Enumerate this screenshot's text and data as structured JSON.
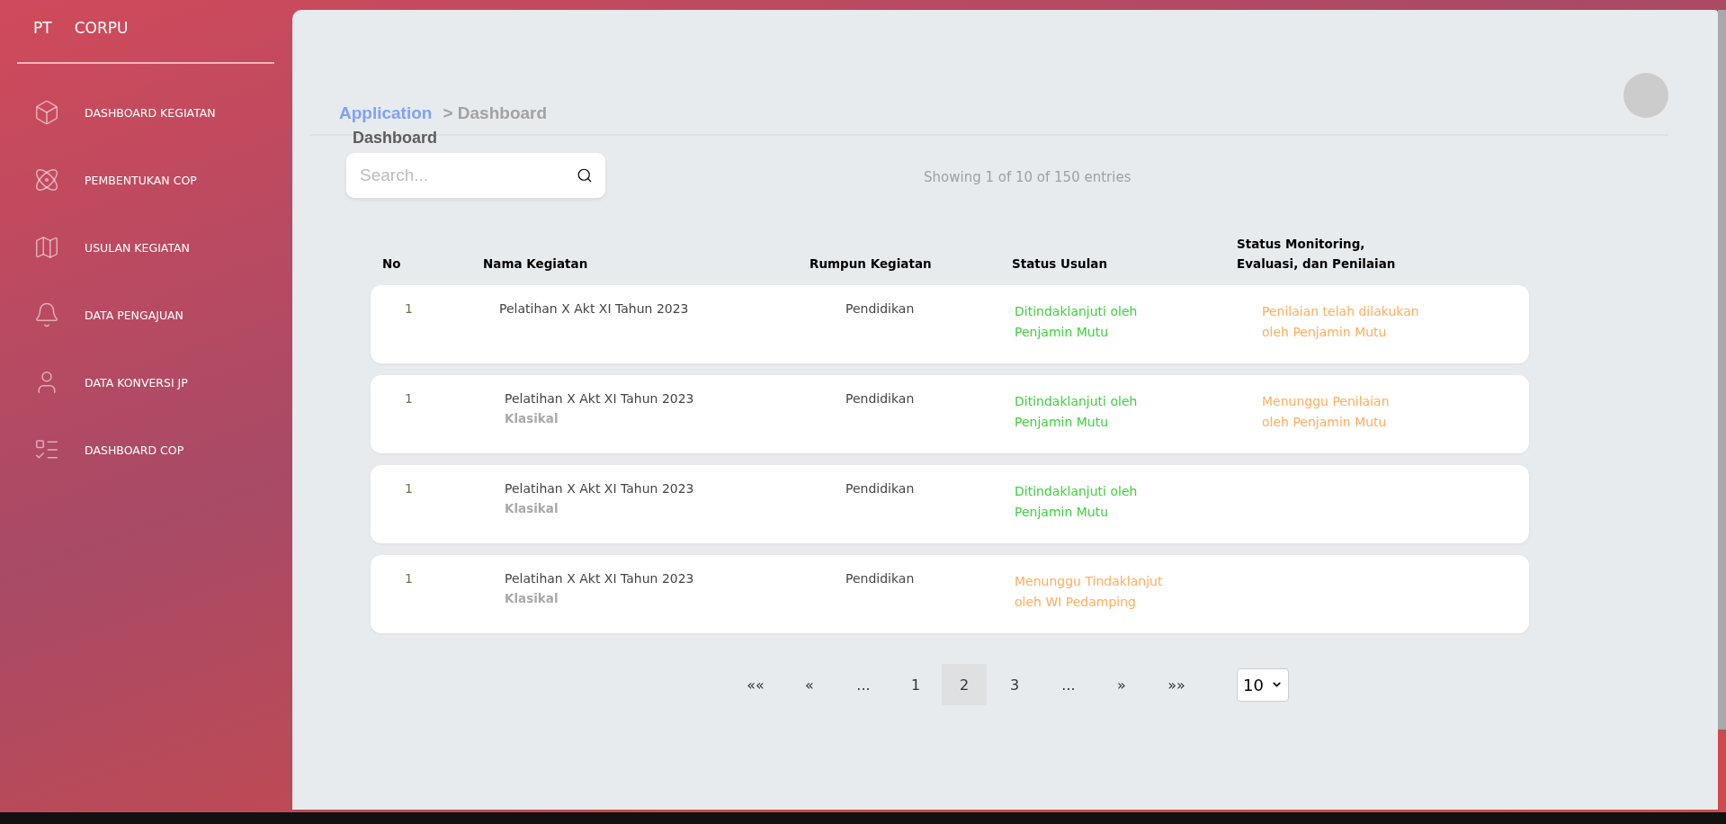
{
  "brand": {
    "prefix": "PT",
    "name": "CORPU"
  },
  "sidebar": {
    "items": [
      {
        "label": "DASHBOARD KEGIATAN"
      },
      {
        "label": "PEMBENTUKAN COP"
      },
      {
        "label": "USULAN KEGIATAN"
      },
      {
        "label": "DATA PENGAJUAN"
      },
      {
        "label": "DATA KONVERSI JP"
      },
      {
        "label": "DASHBOARD COP"
      }
    ]
  },
  "breadcrumb": {
    "root": "Application",
    "current": "> Dashboard"
  },
  "page_title": "Dashboard",
  "search": {
    "placeholder": "Search..."
  },
  "entries_info": "Showing 1 of 10 of 150 entries",
  "table": {
    "columns": [
      "No",
      "Nama  Kegiatan",
      "Rumpun  Kegiatan",
      "Status  Usulan",
      "Status  Monitoring,\nEvaluasi,  dan  Penilaian"
    ],
    "rows": [
      {
        "no": "1",
        "name": "Pelatihan X Akt XI Tahun 2023",
        "rumpun": "Pendidikan",
        "status_usulan": {
          "text": "Ditindaklanjuti oleh\nPenjamin Mutu",
          "color": "#3fcf3f"
        },
        "status_monitoring": {
          "text": "Penilaian telah dilakukan\noleh Penjamin Mutu",
          "color": "#ffad5c"
        }
      },
      {
        "no": "1",
        "name": "Pelatihan X Akt XI Tahun 2023",
        "type": "Klasikal",
        "rumpun": "Pendidikan",
        "status_usulan": {
          "text": "Ditindaklanjuti oleh\nPenjamin Mutu",
          "color": "#3fcf3f"
        },
        "status_monitoring": {
          "text": "Menunggu Penilaian\noleh Penjamin Mutu",
          "color": "#ffad5c"
        }
      },
      {
        "no": "1",
        "name": "Pelatihan X Akt XI Tahun 2023",
        "type": "Klasikal",
        "rumpun": "Pendidikan",
        "status_usulan": {
          "text": "Ditindaklanjuti oleh\nPenjamin Mutu",
          "color": "#3fcf3f"
        }
      },
      {
        "no": "1",
        "name": "Pelatihan X Akt XI Tahun 2023",
        "type": "Klasikal",
        "rumpun": "Pendidikan",
        "status_usulan": {
          "text": "Menunggu Tindaklanjut\noleh WI Pedamping",
          "color": "#ffad5c"
        }
      }
    ]
  },
  "pagination": {
    "items": [
      {
        "label": "««",
        "selected": false
      },
      {
        "label": "«",
        "selected": false
      },
      {
        "label": "...",
        "selected": false
      },
      {
        "label": "1",
        "selected": false
      },
      {
        "label": "2",
        "selected": true
      },
      {
        "label": "3",
        "selected": false
      },
      {
        "label": "...",
        "selected": false
      },
      {
        "label": "»",
        "selected": false
      },
      {
        "label": "»»",
        "selected": false
      }
    ],
    "page_size": "10"
  }
}
